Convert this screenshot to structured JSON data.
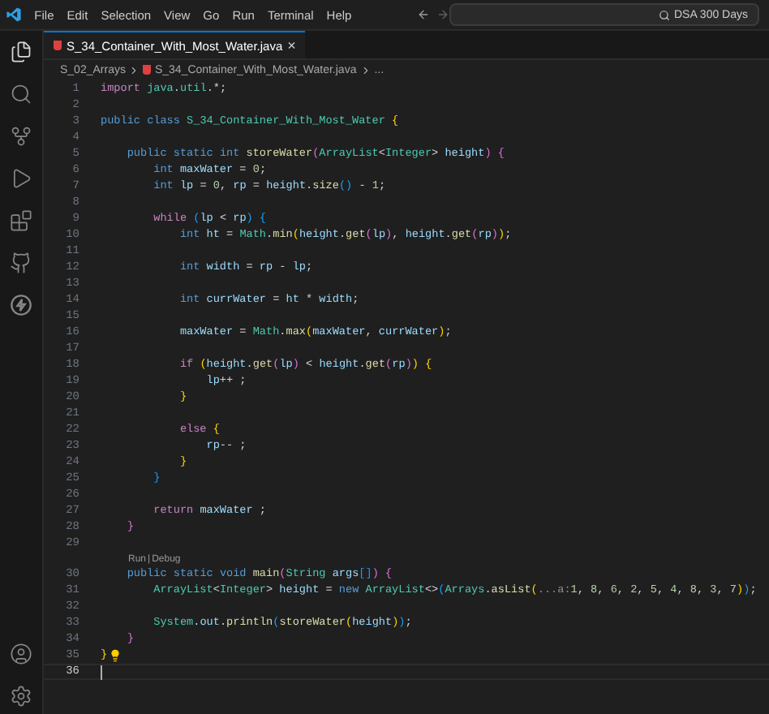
{
  "menu": [
    "File",
    "Edit",
    "Selection",
    "View",
    "Go",
    "Run",
    "Terminal",
    "Help"
  ],
  "search": {
    "value": "DSA 300 Days"
  },
  "tabs": [
    {
      "label": "S_34_Container_With_Most_Water.java",
      "selected": true,
      "close": "×"
    }
  ],
  "breadcrumb": {
    "folder": "S_02_Arrays",
    "file": "S_34_Container_With_Most_Water.java",
    "more": "..."
  },
  "lines": [
    {
      "kind": "code",
      "n": "1",
      "current": false,
      "bulb": false,
      "code": [
        {
          "kind": "ctrl",
          "text": "import"
        },
        {
          "kind": "type",
          "text": " java"
        },
        {
          "kind": "plain",
          "text": "."
        },
        {
          "kind": "type",
          "text": "util"
        },
        {
          "kind": "plain",
          "text": ".*;"
        }
      ]
    },
    {
      "kind": "code",
      "n": "2",
      "current": false,
      "bulb": false
    },
    {
      "kind": "code",
      "n": "3",
      "current": false,
      "bulb": false,
      "code": [
        {
          "kind": "kw",
          "text": "public"
        },
        {
          "kind": "kw",
          "text": " class"
        },
        {
          "kind": "type",
          "text": " S_34_Container_With_Most_Water"
        },
        {
          "kind": "br1",
          "text": " {"
        }
      ]
    },
    {
      "kind": "code",
      "n": "4",
      "current": false,
      "bulb": false
    },
    {
      "kind": "code",
      "n": "5",
      "current": false,
      "bulb": false,
      "code": [
        {
          "kind": "kw",
          "text": "    public"
        },
        {
          "kind": "kw",
          "text": " static"
        },
        {
          "kind": "kw",
          "text": " int"
        },
        {
          "kind": "fn",
          "text": " storeWater"
        },
        {
          "kind": "br2",
          "text": "("
        },
        {
          "kind": "type",
          "text": "ArrayList"
        },
        {
          "kind": "plain",
          "text": "<"
        },
        {
          "kind": "type",
          "text": "Integer"
        },
        {
          "kind": "plain",
          "text": ">"
        },
        {
          "kind": "var",
          "text": " height"
        },
        {
          "kind": "br2",
          "text": ")"
        },
        {
          "kind": "br2",
          "text": " {"
        }
      ]
    },
    {
      "kind": "code",
      "n": "6",
      "current": false,
      "bulb": false,
      "code": [
        {
          "kind": "kw",
          "text": "        int"
        },
        {
          "kind": "var",
          "text": " maxWater"
        },
        {
          "kind": "plain",
          "text": " = "
        },
        {
          "kind": "num",
          "text": "0"
        },
        {
          "kind": "plain",
          "text": ";"
        }
      ]
    },
    {
      "kind": "code",
      "n": "7",
      "current": false,
      "bulb": false,
      "code": [
        {
          "kind": "kw",
          "text": "        int"
        },
        {
          "kind": "var",
          "text": " lp"
        },
        {
          "kind": "plain",
          "text": " = "
        },
        {
          "kind": "num",
          "text": "0"
        },
        {
          "kind": "plain",
          "text": ","
        },
        {
          "kind": "var",
          "text": " rp"
        },
        {
          "kind": "plain",
          "text": " = "
        },
        {
          "kind": "var",
          "text": "height"
        },
        {
          "kind": "plain",
          "text": "."
        },
        {
          "kind": "fn",
          "text": "size"
        },
        {
          "kind": "br3",
          "text": "()"
        },
        {
          "kind": "plain",
          "text": " - "
        },
        {
          "kind": "num",
          "text": "1"
        },
        {
          "kind": "plain",
          "text": ";"
        }
      ]
    },
    {
      "kind": "code",
      "n": "8",
      "current": false,
      "bulb": false
    },
    {
      "kind": "code",
      "n": "9",
      "current": false,
      "bulb": false,
      "code": [
        {
          "kind": "ctrl",
          "text": "        while"
        },
        {
          "kind": "br3",
          "text": " ("
        },
        {
          "kind": "var",
          "text": "lp"
        },
        {
          "kind": "plain",
          "text": " < "
        },
        {
          "kind": "var",
          "text": "rp"
        },
        {
          "kind": "br3",
          "text": ")"
        },
        {
          "kind": "br3",
          "text": " {"
        }
      ]
    },
    {
      "kind": "code",
      "n": "10",
      "current": false,
      "bulb": false,
      "code": [
        {
          "kind": "kw",
          "text": "            int"
        },
        {
          "kind": "var",
          "text": " ht"
        },
        {
          "kind": "plain",
          "text": " = "
        },
        {
          "kind": "type",
          "text": "Math"
        },
        {
          "kind": "plain",
          "text": "."
        },
        {
          "kind": "fn",
          "text": "min"
        },
        {
          "kind": "br1",
          "text": "("
        },
        {
          "kind": "var",
          "text": "height"
        },
        {
          "kind": "plain",
          "text": "."
        },
        {
          "kind": "fn",
          "text": "get"
        },
        {
          "kind": "br2",
          "text": "("
        },
        {
          "kind": "var",
          "text": "lp"
        },
        {
          "kind": "br2",
          "text": ")"
        },
        {
          "kind": "plain",
          "text": ","
        },
        {
          "kind": "var",
          "text": " height"
        },
        {
          "kind": "plain",
          "text": "."
        },
        {
          "kind": "fn",
          "text": "get"
        },
        {
          "kind": "br2",
          "text": "("
        },
        {
          "kind": "var",
          "text": "rp"
        },
        {
          "kind": "br2",
          "text": ")"
        },
        {
          "kind": "br1",
          "text": ")"
        },
        {
          "kind": "plain",
          "text": ";"
        }
      ]
    },
    {
      "kind": "code",
      "n": "11",
      "current": false,
      "bulb": false
    },
    {
      "kind": "code",
      "n": "12",
      "current": false,
      "bulb": false,
      "code": [
        {
          "kind": "kw",
          "text": "            int"
        },
        {
          "kind": "var",
          "text": " width"
        },
        {
          "kind": "plain",
          "text": " = "
        },
        {
          "kind": "var",
          "text": "rp"
        },
        {
          "kind": "plain",
          "text": " - "
        },
        {
          "kind": "var",
          "text": "lp"
        },
        {
          "kind": "plain",
          "text": ";"
        }
      ]
    },
    {
      "kind": "code",
      "n": "13",
      "current": false,
      "bulb": false
    },
    {
      "kind": "code",
      "n": "14",
      "current": false,
      "bulb": false,
      "code": [
        {
          "kind": "kw",
          "text": "            int"
        },
        {
          "kind": "var",
          "text": " currWater"
        },
        {
          "kind": "plain",
          "text": " = "
        },
        {
          "kind": "var",
          "text": "ht"
        },
        {
          "kind": "plain",
          "text": " * "
        },
        {
          "kind": "var",
          "text": "width"
        },
        {
          "kind": "plain",
          "text": ";"
        }
      ]
    },
    {
      "kind": "code",
      "n": "15",
      "current": false,
      "bulb": false
    },
    {
      "kind": "code",
      "n": "16",
      "current": false,
      "bulb": false,
      "code": [
        {
          "kind": "var",
          "text": "            maxWater"
        },
        {
          "kind": "plain",
          "text": " = "
        },
        {
          "kind": "type",
          "text": "Math"
        },
        {
          "kind": "plain",
          "text": "."
        },
        {
          "kind": "fn",
          "text": "max"
        },
        {
          "kind": "br1",
          "text": "("
        },
        {
          "kind": "var",
          "text": "maxWater"
        },
        {
          "kind": "plain",
          "text": ","
        },
        {
          "kind": "var",
          "text": " currWater"
        },
        {
          "kind": "br1",
          "text": ")"
        },
        {
          "kind": "plain",
          "text": ";"
        }
      ]
    },
    {
      "kind": "code",
      "n": "17",
      "current": false,
      "bulb": false
    },
    {
      "kind": "code",
      "n": "18",
      "current": false,
      "bulb": false,
      "code": [
        {
          "kind": "ctrl",
          "text": "            if"
        },
        {
          "kind": "br1",
          "text": " ("
        },
        {
          "kind": "var",
          "text": "height"
        },
        {
          "kind": "plain",
          "text": "."
        },
        {
          "kind": "fn",
          "text": "get"
        },
        {
          "kind": "br2",
          "text": "("
        },
        {
          "kind": "var",
          "text": "lp"
        },
        {
          "kind": "br2",
          "text": ")"
        },
        {
          "kind": "plain",
          "text": " < "
        },
        {
          "kind": "var",
          "text": "height"
        },
        {
          "kind": "plain",
          "text": "."
        },
        {
          "kind": "fn",
          "text": "get"
        },
        {
          "kind": "br2",
          "text": "("
        },
        {
          "kind": "var",
          "text": "rp"
        },
        {
          "kind": "br2",
          "text": ")"
        },
        {
          "kind": "br1",
          "text": ")"
        },
        {
          "kind": "br1",
          "text": " {"
        }
      ]
    },
    {
      "kind": "code",
      "n": "19",
      "current": false,
      "bulb": false,
      "code": [
        {
          "kind": "var",
          "text": "                lp"
        },
        {
          "kind": "plain",
          "text": "++ ;"
        }
      ]
    },
    {
      "kind": "code",
      "n": "20",
      "current": false,
      "bulb": false,
      "code": [
        {
          "kind": "br1",
          "text": "            }"
        }
      ]
    },
    {
      "kind": "code",
      "n": "21",
      "current": false,
      "bulb": false
    },
    {
      "kind": "code",
      "n": "22",
      "current": false,
      "bulb": false,
      "code": [
        {
          "kind": "ctrl",
          "text": "            else"
        },
        {
          "kind": "br1",
          "text": " {"
        }
      ]
    },
    {
      "kind": "code",
      "n": "23",
      "current": false,
      "bulb": false,
      "code": [
        {
          "kind": "var",
          "text": "                rp"
        },
        {
          "kind": "plain",
          "text": "-- ;"
        }
      ]
    },
    {
      "kind": "code",
      "n": "24",
      "current": false,
      "bulb": false,
      "code": [
        {
          "kind": "br1",
          "text": "            }"
        }
      ]
    },
    {
      "kind": "code",
      "n": "25",
      "current": false,
      "bulb": false,
      "code": [
        {
          "kind": "br3",
          "text": "        }"
        }
      ]
    },
    {
      "kind": "code",
      "n": "26",
      "current": false,
      "bulb": false
    },
    {
      "kind": "code",
      "n": "27",
      "current": false,
      "bulb": false,
      "code": [
        {
          "kind": "ctrl",
          "text": "        return"
        },
        {
          "kind": "var",
          "text": " maxWater"
        },
        {
          "kind": "plain",
          "text": " ;"
        }
      ]
    },
    {
      "kind": "code",
      "n": "28",
      "current": false,
      "bulb": false,
      "code": [
        {
          "kind": "br2",
          "text": "    }"
        }
      ]
    },
    {
      "kind": "code",
      "n": "29",
      "current": false,
      "bulb": false
    },
    {
      "kind": "codelens",
      "links": [
        "Run",
        "Debug"
      ],
      "separator": "|"
    },
    {
      "kind": "code",
      "n": "30",
      "current": false,
      "bulb": false,
      "code": [
        {
          "kind": "kw",
          "text": "    public"
        },
        {
          "kind": "kw",
          "text": " static"
        },
        {
          "kind": "kw",
          "text": " void"
        },
        {
          "kind": "fn",
          "text": " main"
        },
        {
          "kind": "br2",
          "text": "("
        },
        {
          "kind": "type",
          "text": "String"
        },
        {
          "kind": "var",
          "text": " args"
        },
        {
          "kind": "br3",
          "text": "[]"
        },
        {
          "kind": "br2",
          "text": ")"
        },
        {
          "kind": "br2",
          "text": " {"
        }
      ]
    },
    {
      "kind": "code",
      "n": "31",
      "current": false,
      "bulb": false,
      "code": [
        {
          "kind": "type",
          "text": "        ArrayList"
        },
        {
          "kind": "plain",
          "text": "<"
        },
        {
          "kind": "type",
          "text": "Integer"
        },
        {
          "kind": "plain",
          "text": ">"
        },
        {
          "kind": "var",
          "text": " height"
        },
        {
          "kind": "plain",
          "text": " = "
        },
        {
          "kind": "kw",
          "text": "new"
        },
        {
          "kind": "type",
          "text": " ArrayList"
        },
        {
          "kind": "plain",
          "text": "<>"
        },
        {
          "kind": "br3",
          "text": "("
        },
        {
          "kind": "type",
          "text": "Arrays"
        },
        {
          "kind": "plain",
          "text": "."
        },
        {
          "kind": "fn",
          "text": "asList"
        },
        {
          "kind": "br1",
          "text": "("
        },
        {
          "kind": "hint",
          "text": "...a:"
        },
        {
          "kind": "num",
          "text": "1"
        },
        {
          "kind": "plain",
          "text": ","
        },
        {
          "kind": "num",
          "text": " 8"
        },
        {
          "kind": "plain",
          "text": ","
        },
        {
          "kind": "num",
          "text": " 6"
        },
        {
          "kind": "plain",
          "text": ","
        },
        {
          "kind": "num",
          "text": " 2"
        },
        {
          "kind": "plain",
          "text": ","
        },
        {
          "kind": "num",
          "text": " 5"
        },
        {
          "kind": "plain",
          "text": ","
        },
        {
          "kind": "num",
          "text": " 4"
        },
        {
          "kind": "plain",
          "text": ","
        },
        {
          "kind": "num",
          "text": " 8"
        },
        {
          "kind": "plain",
          "text": ","
        },
        {
          "kind": "num",
          "text": " 3"
        },
        {
          "kind": "plain",
          "text": ","
        },
        {
          "kind": "num",
          "text": " 7"
        },
        {
          "kind": "br1",
          "text": ")"
        },
        {
          "kind": "br3",
          "text": ")"
        },
        {
          "kind": "plain",
          "text": ";"
        }
      ]
    },
    {
      "kind": "code",
      "n": "32",
      "current": false,
      "bulb": false
    },
    {
      "kind": "code",
      "n": "33",
      "current": false,
      "bulb": false,
      "code": [
        {
          "kind": "type",
          "text": "        System"
        },
        {
          "kind": "plain",
          "text": "."
        },
        {
          "kind": "var",
          "text": "out"
        },
        {
          "kind": "plain",
          "text": "."
        },
        {
          "kind": "fn",
          "text": "println"
        },
        {
          "kind": "br3",
          "text": "("
        },
        {
          "kind": "fn",
          "text": "storeWater"
        },
        {
          "kind": "br1",
          "text": "("
        },
        {
          "kind": "var",
          "text": "height"
        },
        {
          "kind": "br1",
          "text": ")"
        },
        {
          "kind": "br3",
          "text": ")"
        },
        {
          "kind": "plain",
          "text": ";"
        }
      ]
    },
    {
      "kind": "code",
      "n": "34",
      "current": false,
      "bulb": false,
      "code": [
        {
          "kind": "br2",
          "text": "    }"
        }
      ]
    },
    {
      "kind": "code",
      "n": "35",
      "current": false,
      "bulb": true,
      "code": [
        {
          "kind": "br1",
          "text": "}"
        }
      ]
    },
    {
      "kind": "code",
      "n": "36",
      "current": true,
      "bulb": false
    }
  ]
}
